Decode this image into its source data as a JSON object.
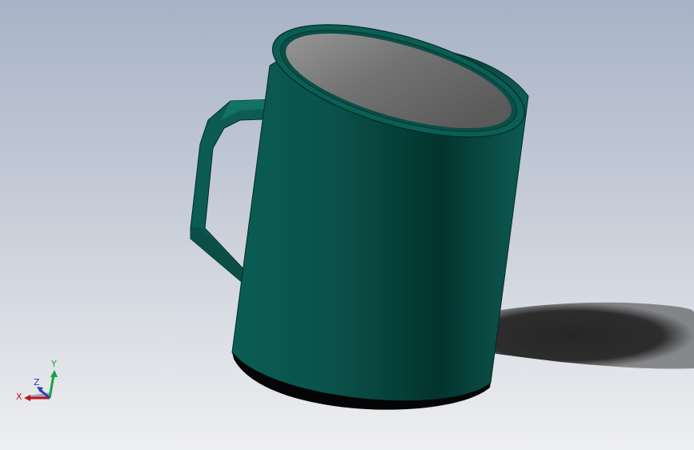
{
  "viewport": {
    "background_top": "#a7b3c6",
    "background_bottom": "#ecedf0"
  },
  "model": {
    "body_color": "#0b5f55",
    "body_dark": "#03352f",
    "interior_color": "#6f6f6f",
    "shadow_color": "#2a2a2a"
  },
  "triad": {
    "x_label": "X",
    "y_label": "Y",
    "z_label": "Z",
    "x_color": "#c0141b",
    "y_color": "#19a23a",
    "z_color": "#2b3fb0"
  }
}
